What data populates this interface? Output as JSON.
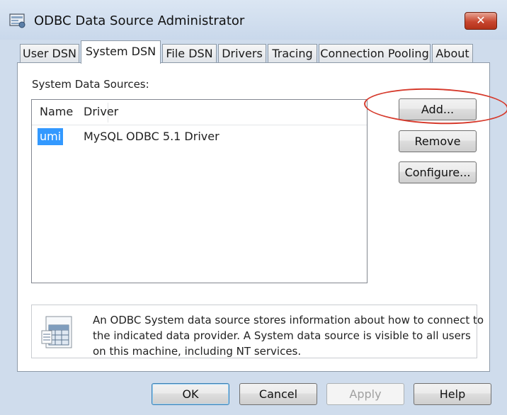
{
  "window": {
    "title": "ODBC Data Source Administrator",
    "close_label": "✕"
  },
  "tabs": [
    {
      "label": "User DSN",
      "selected": false
    },
    {
      "label": "System DSN",
      "selected": true
    },
    {
      "label": "File DSN",
      "selected": false
    },
    {
      "label": "Drivers",
      "selected": false
    },
    {
      "label": "Tracing",
      "selected": false
    },
    {
      "label": "Connection Pooling",
      "selected": false
    },
    {
      "label": "About",
      "selected": false
    }
  ],
  "system_dsn": {
    "group_label": "System Data Sources:",
    "columns": [
      "Name",
      "Driver"
    ],
    "rows": [
      {
        "name": "umi",
        "driver": "MySQL ODBC 5.1 Driver",
        "selected": true
      }
    ],
    "buttons": {
      "add": "Add...",
      "remove": "Remove",
      "configure": "Configure..."
    },
    "info_lines": [
      "An ODBC System data source stores information about how to connect to",
      "the indicated data provider.   A System data source is visible to all users",
      "on this machine, including NT services."
    ]
  },
  "footer": {
    "ok": "OK",
    "cancel": "Cancel",
    "apply": "Apply",
    "help": "Help"
  },
  "annotation": {
    "highlight_color": "#d63a2c"
  }
}
